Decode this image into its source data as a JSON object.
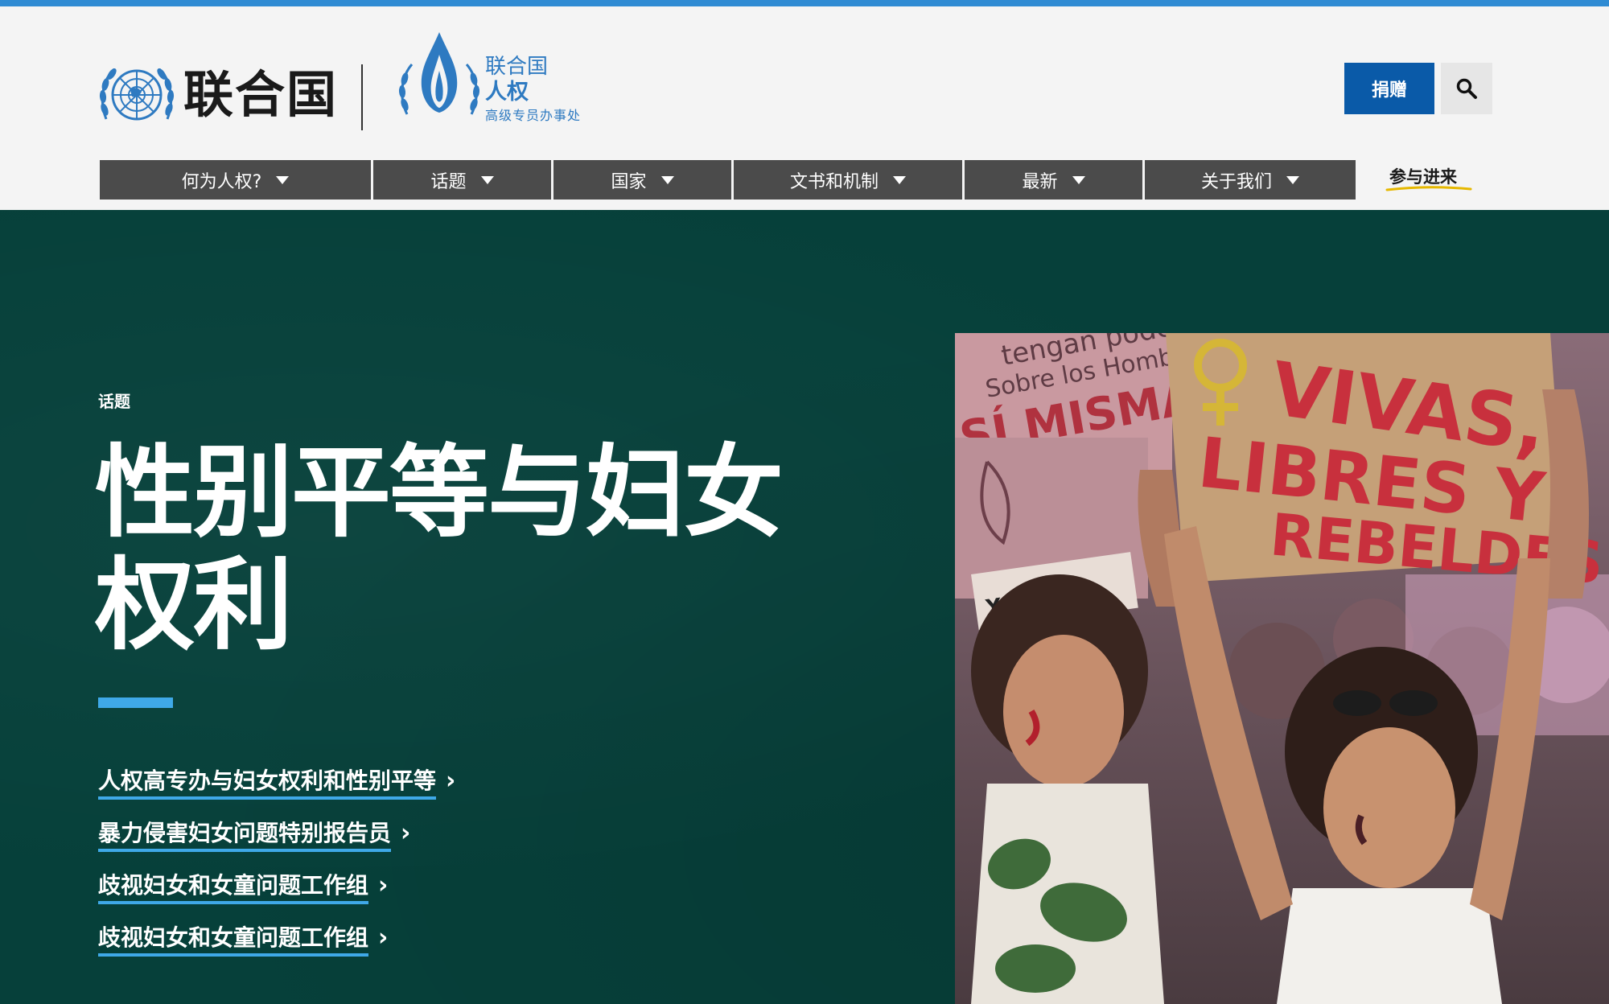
{
  "colors": {
    "top_line": "#2f8bd3",
    "brand_blue": "#0a5aa8",
    "ohchr_blue": "#2e7ac1",
    "nav_bg": "#4b4b4b",
    "hero_bg": "#06403a",
    "accent": "#3fa9e8",
    "engage_underline": "#e6b800"
  },
  "header": {
    "un_name": "联合国",
    "ohchr_line1": "联合国",
    "ohchr_line2": "人权",
    "ohchr_line3": "高级专员办事处",
    "donate_label": "捐赠",
    "search_icon": "search-icon"
  },
  "nav": {
    "items": [
      {
        "label": "何为人权?"
      },
      {
        "label": "话题"
      },
      {
        "label": "国家"
      },
      {
        "label": "文书和机制"
      },
      {
        "label": "最新"
      },
      {
        "label": "关于我们"
      }
    ],
    "engage_label": "参与进来"
  },
  "hero": {
    "eyebrow": "话题",
    "title": "性别平等与妇女权利",
    "links": [
      {
        "label": "人权高专办与妇女权利和性别平等"
      },
      {
        "label": "暴力侵害妇女问题特别报告员"
      },
      {
        "label": "歧视妇女和女童问题工作组"
      },
      {
        "label": "歧视妇女和女童问题工作组"
      }
    ],
    "photo": {
      "sign_1": "VIVAS,",
      "sign_2": "LIBRES Y",
      "sign_3": "REBELDES",
      "sign_left_1": "tengan poder",
      "sign_left_2": "Sobre los Hombres",
      "sign_left_3": "SÍ MISMAS",
      "sign_yo": "YO"
    }
  }
}
